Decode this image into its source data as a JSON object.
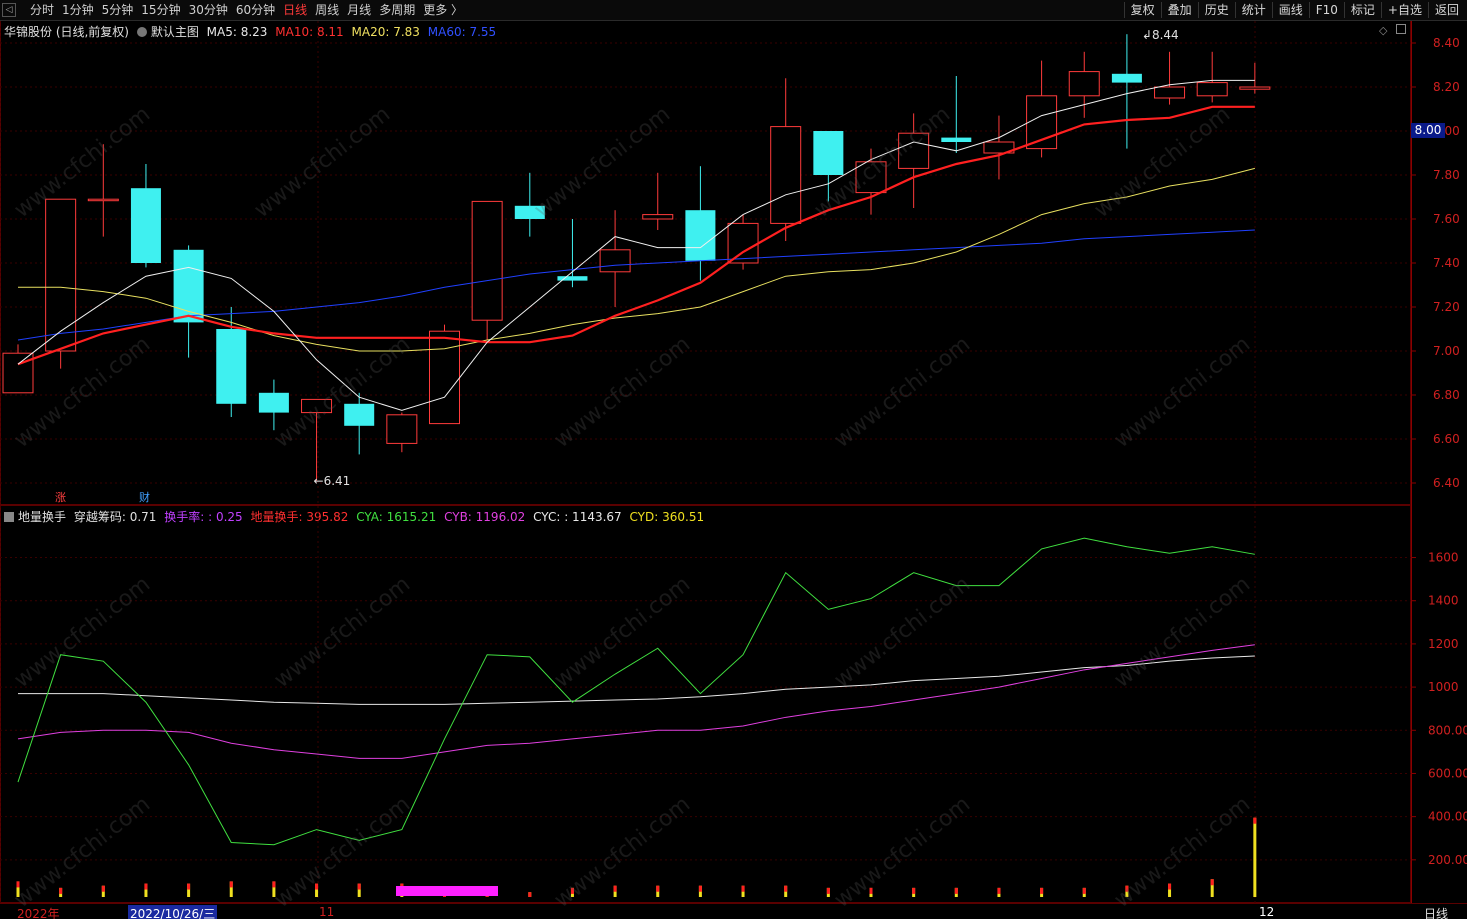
{
  "toolbar": {
    "back_icon": "◁",
    "periods": [
      "分时",
      "1分钟",
      "5分钟",
      "15分钟",
      "30分钟",
      "60分钟",
      "日线",
      "周线",
      "月线",
      "多周期",
      "更多 〉"
    ],
    "active_period": "日线",
    "tools": [
      "复权",
      "叠加",
      "历史",
      "统计",
      "画线",
      "F10",
      "标记",
      "+自选",
      "返回"
    ]
  },
  "main_legend": {
    "title": "华锦股份 (日线,前复权)",
    "template": "默认主图",
    "ma5": "MA5: 8.23",
    "ma10": "MA10: 8.11",
    "ma20": "MA20: 7.83",
    "ma60": "MA60: 7.55",
    "colors": {
      "ma5": "#e8e8e8",
      "ma10": "#ff2020",
      "ma20": "#e8e060",
      "ma60": "#2040ff"
    }
  },
  "indicator_legend": {
    "name": "地量换手",
    "cross": "穿越筹码: 0.71",
    "turnover": "换手率: : 0.25",
    "dl": "地量换手: 395.82",
    "cya": "CYA: 1615.21",
    "cyb": "CYB: 1196.02",
    "cyc": "CYC: : 1143.67",
    "cyd": "CYD: 360.51"
  },
  "price_axis": [
    "8.40",
    "8.20",
    "8.00",
    "7.80",
    "7.60",
    "7.40",
    "7.20",
    "7.00",
    "6.80",
    "6.60",
    "6.40"
  ],
  "current_price": "8.00",
  "indicator_axis": [
    "1600",
    "1400",
    "1200",
    "1000",
    "800.00",
    "600.00",
    "400.00",
    "200.00"
  ],
  "annotations": {
    "high": "8.44",
    "low": "6.41",
    "zhang": "涨",
    "cai": "财"
  },
  "dates": {
    "year": "2022年",
    "cursor_date": "2022/10/26/三",
    "nov": "11",
    "dec": "12",
    "period": "日线"
  },
  "watermark": "www.cfchi.com",
  "chart_data": {
    "type": "candlestick",
    "candles": [
      {
        "o": 6.81,
        "c": 6.99,
        "h": 7.03,
        "l": 6.93
      },
      {
        "o": 7.0,
        "c": 7.69,
        "h": 7.69,
        "l": 6.92
      },
      {
        "o": 7.69,
        "c": 7.69,
        "h": 7.94,
        "l": 7.52
      },
      {
        "o": 7.74,
        "c": 7.4,
        "h": 7.85,
        "l": 7.38
      },
      {
        "o": 7.46,
        "c": 7.13,
        "h": 7.48,
        "l": 6.97
      },
      {
        "o": 7.1,
        "c": 6.76,
        "h": 7.2,
        "l": 6.7
      },
      {
        "o": 6.81,
        "c": 6.72,
        "h": 6.87,
        "l": 6.64
      },
      {
        "o": 6.72,
        "c": 6.78,
        "h": 6.78,
        "l": 6.41
      },
      {
        "o": 6.76,
        "c": 6.66,
        "h": 6.81,
        "l": 6.53
      },
      {
        "o": 6.58,
        "c": 6.71,
        "h": 6.72,
        "l": 6.54
      },
      {
        "o": 6.67,
        "c": 7.09,
        "h": 7.12,
        "l": 6.67
      },
      {
        "o": 7.14,
        "c": 7.68,
        "h": 7.65,
        "l": 7.05
      },
      {
        "o": 7.66,
        "c": 7.6,
        "h": 7.81,
        "l": 7.52
      },
      {
        "o": 7.34,
        "c": 7.32,
        "h": 7.6,
        "l": 7.29
      },
      {
        "o": 7.36,
        "c": 7.46,
        "h": 7.64,
        "l": 7.2
      },
      {
        "o": 7.6,
        "c": 7.62,
        "h": 7.81,
        "l": 7.55
      },
      {
        "o": 7.64,
        "c": 7.41,
        "h": 7.84,
        "l": 7.32
      },
      {
        "o": 7.4,
        "c": 7.58,
        "h": 7.62,
        "l": 7.37
      },
      {
        "o": 7.58,
        "c": 8.02,
        "h": 8.24,
        "l": 7.5
      },
      {
        "o": 8.0,
        "c": 7.8,
        "h": 8.0,
        "l": 7.68
      },
      {
        "o": 7.72,
        "c": 7.86,
        "h": 7.92,
        "l": 7.62
      },
      {
        "o": 7.83,
        "c": 7.99,
        "h": 8.08,
        "l": 7.65
      },
      {
        "o": 7.97,
        "c": 7.95,
        "h": 8.25,
        "l": 7.9
      },
      {
        "o": 7.9,
        "c": 7.95,
        "h": 8.07,
        "l": 7.78
      },
      {
        "o": 7.92,
        "c": 8.16,
        "h": 8.32,
        "l": 7.88
      },
      {
        "o": 8.16,
        "c": 8.27,
        "h": 8.36,
        "l": 8.06
      },
      {
        "o": 8.26,
        "c": 8.22,
        "h": 8.44,
        "l": 7.92
      },
      {
        "o": 8.15,
        "c": 8.2,
        "h": 8.36,
        "l": 8.12
      },
      {
        "o": 8.16,
        "c": 8.22,
        "h": 8.36,
        "l": 8.13
      },
      {
        "o": 8.19,
        "c": 8.2,
        "h": 8.31,
        "l": 8.17
      }
    ],
    "ma5": [
      6.94,
      7.09,
      7.22,
      7.34,
      7.38,
      7.33,
      7.18,
      6.96,
      6.79,
      6.73,
      6.79,
      7.04,
      7.2,
      7.36,
      7.52,
      7.47,
      7.47,
      7.62,
      7.71,
      7.76,
      7.87,
      7.95,
      7.91,
      7.97,
      8.07,
      8.12,
      8.17,
      8.21,
      8.23,
      8.23
    ],
    "ma10": [
      6.94,
      7.01,
      7.08,
      7.12,
      7.16,
      7.11,
      7.08,
      7.06,
      7.06,
      7.06,
      7.06,
      7.04,
      7.04,
      7.07,
      7.16,
      7.23,
      7.31,
      7.45,
      7.56,
      7.64,
      7.7,
      7.79,
      7.85,
      7.89,
      7.96,
      8.03,
      8.05,
      8.06,
      8.11,
      8.11
    ],
    "ma20": [
      7.29,
      7.29,
      7.27,
      7.24,
      7.18,
      7.13,
      7.07,
      7.03,
      7.0,
      7.0,
      7.01,
      7.05,
      7.08,
      7.12,
      7.15,
      7.17,
      7.2,
      7.27,
      7.34,
      7.36,
      7.37,
      7.4,
      7.45,
      7.53,
      7.62,
      7.67,
      7.7,
      7.75,
      7.78,
      7.83
    ],
    "ma60": [
      7.05,
      7.08,
      7.1,
      7.13,
      7.16,
      7.17,
      7.18,
      7.2,
      7.22,
      7.25,
      7.29,
      7.32,
      7.35,
      7.37,
      7.39,
      7.4,
      7.41,
      7.42,
      7.43,
      7.44,
      7.45,
      7.46,
      7.47,
      7.48,
      7.49,
      7.51,
      7.52,
      7.53,
      7.54,
      7.55
    ],
    "cya": [
      560,
      1150,
      1120,
      930,
      640,
      280,
      270,
      340,
      290,
      340,
      760,
      1150,
      1140,
      930,
      1060,
      1180,
      970,
      1150,
      1530,
      1360,
      1410,
      1530,
      1470,
      1470,
      1640,
      1690,
      1650,
      1620,
      1650,
      1615
    ],
    "cyb": [
      760,
      790,
      800,
      800,
      790,
      740,
      710,
      690,
      670,
      670,
      700,
      730,
      740,
      760,
      780,
      800,
      800,
      820,
      860,
      890,
      910,
      940,
      970,
      1000,
      1040,
      1080,
      1110,
      1140,
      1170,
      1196
    ],
    "cyc": [
      970,
      970,
      970,
      960,
      950,
      940,
      930,
      925,
      920,
      920,
      920,
      925,
      930,
      935,
      940,
      945,
      955,
      970,
      990,
      1000,
      1010,
      1030,
      1040,
      1050,
      1070,
      1090,
      1100,
      1120,
      1135,
      1144
    ],
    "cyd_bars": [
      100,
      70,
      80,
      90,
      90,
      100,
      100,
      90,
      90,
      90,
      50,
      50,
      50,
      70,
      80,
      80,
      80,
      80,
      80,
      70,
      70,
      70,
      70,
      70,
      70,
      70,
      80,
      90,
      110,
      395
    ],
    "price_range": [
      6.3,
      8.5
    ],
    "indicator_range": [
      0,
      1760
    ]
  }
}
